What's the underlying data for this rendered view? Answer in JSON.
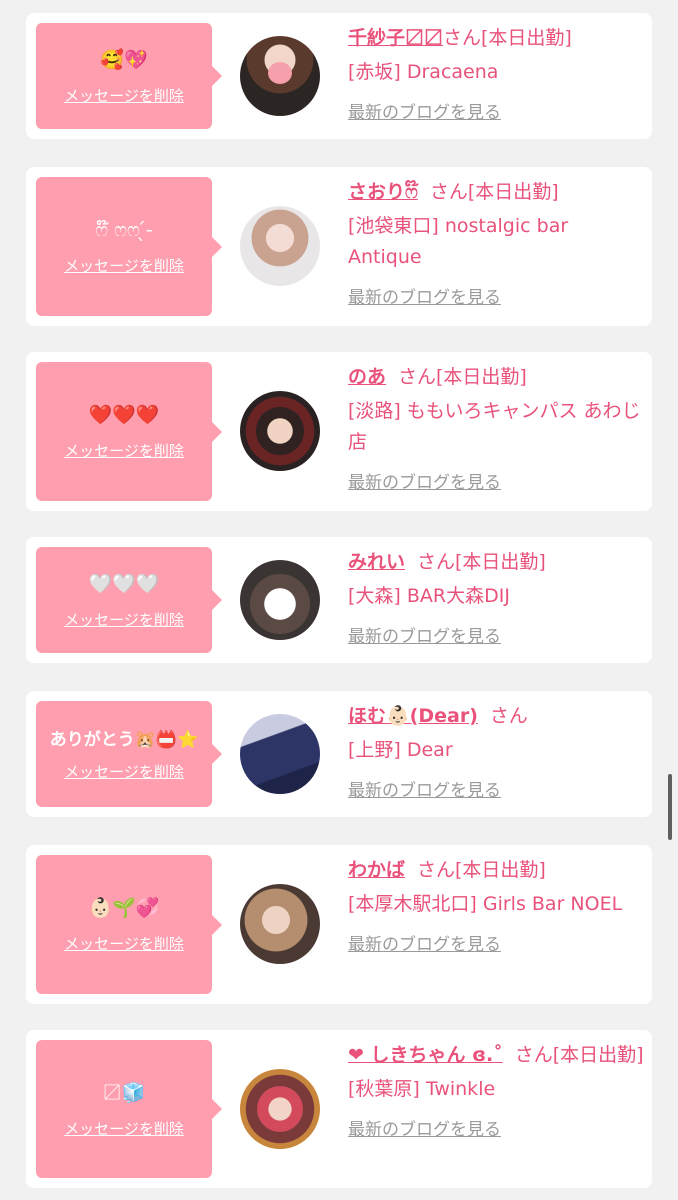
{
  "cards": [
    {
      "message": "🥰💖",
      "name": "千紗子〼〼",
      "suffix": "さん[本日出勤]",
      "shop": "[赤坂] Dracaena",
      "blog": "最新のブログを見る",
      "delete": "メッセージを削除"
    },
    {
      "message": "ෆ໊ ෆෆ ̖́-",
      "name": "さおりෆ໊",
      "suffix": "さん[本日出勤]",
      "shop": "[池袋東口] nostalgic bar Antique",
      "blog": "最新のブログを見る",
      "delete": "メッセージを削除"
    },
    {
      "message": "❤️❤️❤️",
      "name": "のあ",
      "suffix": "さん[本日出勤]",
      "shop": "[淡路] ももいろキャンパス あわじ店",
      "blog": "最新のブログを見る",
      "delete": "メッセージを削除"
    },
    {
      "message": "🤍🤍🤍",
      "name": "みれい",
      "suffix": "さん[本日出勤]",
      "shop": "[大森] BAR大森DIJ",
      "blog": "最新のブログを見る",
      "delete": "メッセージを削除"
    },
    {
      "message": "ありがとう🐹📛⭐",
      "name": "ほむ👶🏻(Dear)",
      "suffix": "さん",
      "shop": "[上野] Dear",
      "blog": "最新のブログを見る",
      "delete": "メッセージを削除"
    },
    {
      "message": "👶🏻🌱💞",
      "name": "わかば",
      "suffix": "さん[本日出勤]",
      "shop": "[本厚木駅北口] Girls Bar NOEL",
      "blog": "最新のブログを見る",
      "delete": "メッセージを削除"
    },
    {
      "message": "〼🧊",
      "name": "❤︎ しきちゃん ɞ.˚",
      "suffix": "さん[本日出勤]",
      "shop": "[秋葉原] Twinkle",
      "blog": "最新のブログを見る",
      "delete": "メッセージを削除"
    }
  ],
  "colors": {
    "bubble": "#ff9eae",
    "name": "#e9527a",
    "link": "#9a9a9a",
    "background": "#f1f1f2"
  }
}
